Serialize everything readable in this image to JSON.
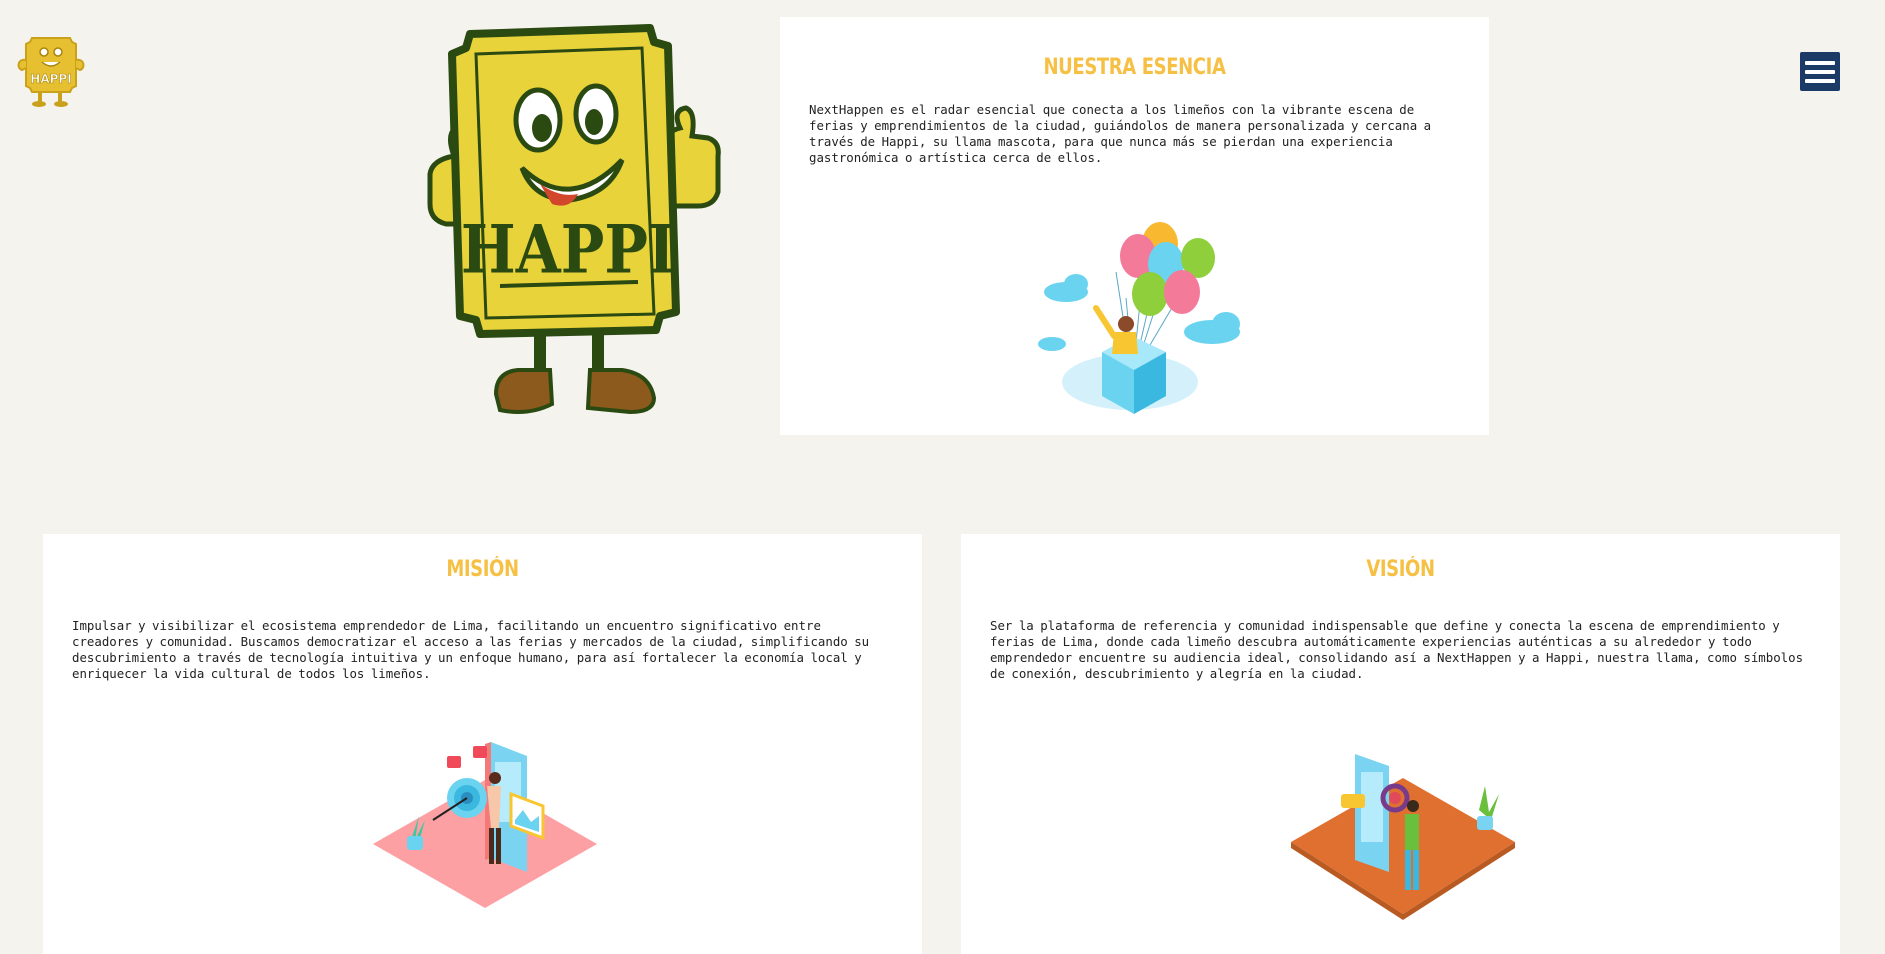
{
  "header": {
    "logo_text": "HAPPI",
    "menu_icon": "hamburger-icon"
  },
  "mascot": {
    "text": "HAPPI"
  },
  "esencia": {
    "title": "NUESTRA ESENCIA",
    "body": "NextHappen es el radar esencial que conecta a los limeños con la vibrante escena de ferias y emprendimientos de la ciudad, guiándolos de manera personalizada y cercana a través de Happi, su llama mascota, para que nunca más se pierdan una experiencia gastronómica o artística cerca de ellos.",
    "illustration": "balloons-illustration"
  },
  "mision": {
    "title": "MISIÓN",
    "body": "Impulsar y visibilizar el ecosistema emprendedor de Lima, facilitando un encuentro significativo entre creadores y comunidad. Buscamos democratizar el acceso a las ferias y mercados de la ciudad, simplificando su descubrimiento a través de tecnología intuitiva y un enfoque humano, para así fortalecer la economía local y enriquecer la vida cultural de todos los limeños.",
    "illustration": "target-illustration"
  },
  "vision": {
    "title": "VISIÓN",
    "body": "Ser la plataforma de referencia y comunidad indispensable que define y conecta la escena de emprendimiento y ferias de Lima, donde cada limeño descubra automáticamente experiencias auténticas a su alrededor y todo emprendedor encuentre su audiencia ideal, consolidando así a NextHappen y a Happi, nuestra llama, como símbolos de conexión, descubrimiento y alegría en la ciudad.",
    "illustration": "search-illustration"
  },
  "colors": {
    "background": "#f4f3ee",
    "accent_title": "#f5c044",
    "menu_button": "#1c3a66",
    "mascot_yellow": "#e8d33a",
    "mascot_green": "#2a4a12"
  }
}
